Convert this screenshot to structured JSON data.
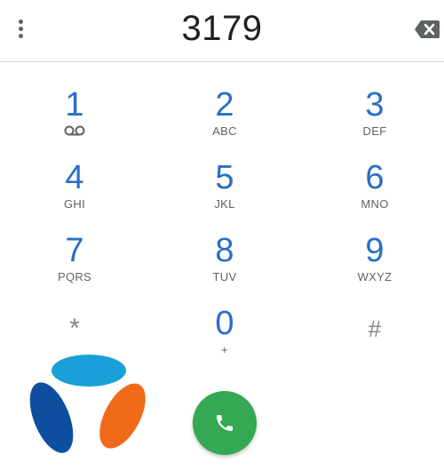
{
  "dialer": {
    "number": "3179"
  },
  "keys": [
    {
      "digit": "1",
      "letters": ""
    },
    {
      "digit": "2",
      "letters": "ABC"
    },
    {
      "digit": "3",
      "letters": "DEF"
    },
    {
      "digit": "4",
      "letters": "GHI"
    },
    {
      "digit": "5",
      "letters": "JKL"
    },
    {
      "digit": "6",
      "letters": "MNO"
    },
    {
      "digit": "7",
      "letters": "PQRS"
    },
    {
      "digit": "8",
      "letters": "TUV"
    },
    {
      "digit": "9",
      "letters": "WXYZ"
    },
    {
      "digit": "*",
      "letters": ""
    },
    {
      "digit": "0",
      "letters": "+"
    },
    {
      "digit": "#",
      "letters": ""
    }
  ],
  "icons": {
    "menu": "more-vert-icon",
    "backspace": "backspace-icon",
    "voicemail": "voicemail-icon",
    "call": "phone-icon",
    "logo": "bouygues-logo"
  },
  "colors": {
    "digit": "#2a6ec6",
    "call_button": "#34a853",
    "logo_top": "#1aa0d8",
    "logo_left": "#0d4f9e",
    "logo_right": "#ef6b1a"
  }
}
